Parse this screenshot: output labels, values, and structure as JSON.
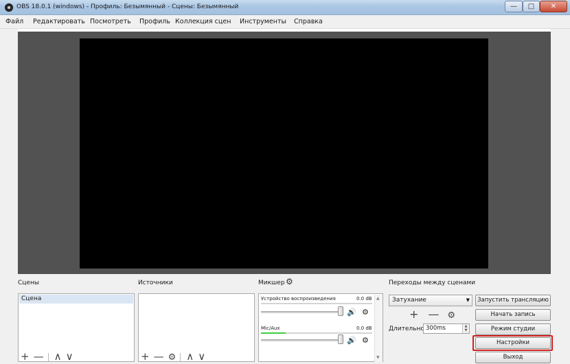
{
  "window": {
    "title": "OBS 18.0.1 (windows) - Профиль: Безымянный - Сцены: Безымянный",
    "minimize_glyph": "—",
    "maximize_glyph": "□",
    "close_glyph": "✕"
  },
  "menu": [
    "Файл",
    "Редактировать",
    "Посмотреть",
    "Профиль",
    "Коллекция сцен",
    "Инструменты",
    "Справка"
  ],
  "docks": {
    "scenes": {
      "title": "Сцены",
      "items": [
        "Сцена"
      ],
      "tools": [
        "+",
        "—",
        "∧",
        "∨"
      ]
    },
    "sources": {
      "title": "Источники",
      "tools": [
        "+",
        "—",
        "⚙",
        "∧",
        "∨"
      ]
    },
    "mixer": {
      "title": "Микшер",
      "gear_icon": "gear-icon",
      "channels": [
        {
          "name": "Устройство воспроизведения",
          "db": "0.0 dB",
          "level": 0.0,
          "volume": 1.0
        },
        {
          "name": "Mic/Aux",
          "db": "0.0 dB",
          "level": 0.22,
          "volume": 1.0
        }
      ],
      "speaker_glyph": "🔊",
      "gear_glyph": "⚙"
    },
    "transitions": {
      "title": "Переходы между сценами",
      "selected": "Затухание",
      "dropdown_glyph": "▼",
      "tools": [
        "+",
        "—",
        "⚙"
      ],
      "duration_label": "Длительность",
      "duration_value": "300ms"
    }
  },
  "controls": {
    "start_stream": "Запустить трансляцию",
    "start_record": "Начать запись",
    "studio_mode": "Режим студии",
    "settings": "Настройки",
    "exit": "Выход"
  },
  "colors": {
    "preview_background": "#525252",
    "canvas": "#000000",
    "highlight": "#d42020",
    "meter_green": "#3ccf3c"
  }
}
